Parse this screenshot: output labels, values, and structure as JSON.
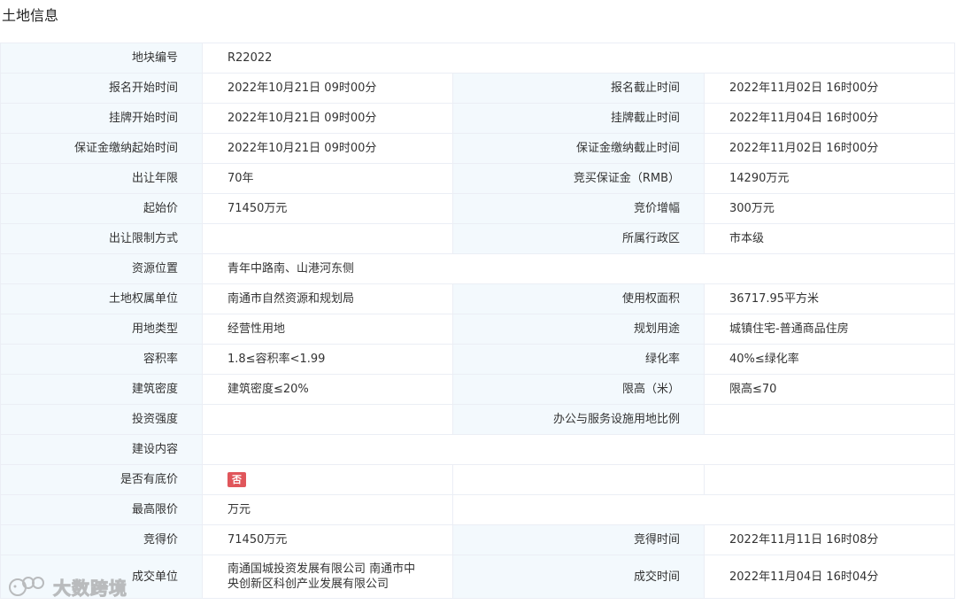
{
  "page_title": "土地信息",
  "rows": {
    "parcel_no": {
      "label": "地块编号",
      "value": "R22022"
    },
    "reg_start": {
      "label": "报名开始时间",
      "value": "2022年10月21日 09时00分"
    },
    "reg_end": {
      "label": "报名截止时间",
      "value": "2022年11月02日 16时00分"
    },
    "list_start": {
      "label": "挂牌开始时间",
      "value": "2022年10月21日 09时00分"
    },
    "list_end": {
      "label": "挂牌截止时间",
      "value": "2022年11月04日 16时00分"
    },
    "deposit_start": {
      "label": "保证金缴纳起始时间",
      "value": "2022年10月21日 09时00分"
    },
    "deposit_end": {
      "label": "保证金缴纳截止时间",
      "value": "2022年11月02日 16时00分"
    },
    "term": {
      "label": "出让年限",
      "value": "70年"
    },
    "bid_deposit": {
      "label": "竞买保证金（RMB）",
      "value": "14290万元"
    },
    "start_price": {
      "label": "起始价",
      "value": "71450万元"
    },
    "increment": {
      "label": "竞价增幅",
      "value": "300万元"
    },
    "restriction": {
      "label": "出让限制方式",
      "value": ""
    },
    "district": {
      "label": "所属行政区",
      "value": "市本级"
    },
    "location": {
      "label": "资源位置",
      "value": "青年中路南、山港河东侧"
    },
    "owner": {
      "label": "土地权属单位",
      "value": "南通市自然资源和规划局"
    },
    "area": {
      "label": "使用权面积",
      "value": "36717.95平方米"
    },
    "land_type": {
      "label": "用地类型",
      "value": "经营性用地"
    },
    "planned_use": {
      "label": "规划用途",
      "value": "城镇住宅-普通商品住房"
    },
    "far": {
      "label": "容积率",
      "value": "1.8≤容积率<1.99"
    },
    "green": {
      "label": "绿化率",
      "value": "40%≤绿化率"
    },
    "density": {
      "label": "建筑密度",
      "value": "建筑密度≤20%"
    },
    "height": {
      "label": "限高（米）",
      "value": "限高≤70"
    },
    "intensity": {
      "label": "投资强度",
      "value": ""
    },
    "office_ratio": {
      "label": "办公与服务设施用地比例",
      "value": ""
    },
    "content": {
      "label": "建设内容",
      "value": ""
    },
    "reserve": {
      "label": "是否有底价",
      "badge": "否",
      "badge_color": "#e0565b"
    },
    "max_price": {
      "label": "最高限价",
      "value": "万元"
    },
    "deal_price": {
      "label": "竞得价",
      "value": "71450万元"
    },
    "deal_time": {
      "label": "竞得时间",
      "value": "2022年11月11日 16时08分"
    },
    "buyer": {
      "label": "成交单位",
      "value": "南通国城投资发展有限公司 南通市中央创新区科创产业发展有限公司"
    },
    "close_time": {
      "label": "成交时间",
      "value": "2022年11月04日 16时04分"
    }
  },
  "watermark": {
    "text": "大数跨境"
  },
  "colors": {
    "label_bg": "#f3f9fd",
    "border": "#ebeef5",
    "badge": "#e0565b"
  }
}
